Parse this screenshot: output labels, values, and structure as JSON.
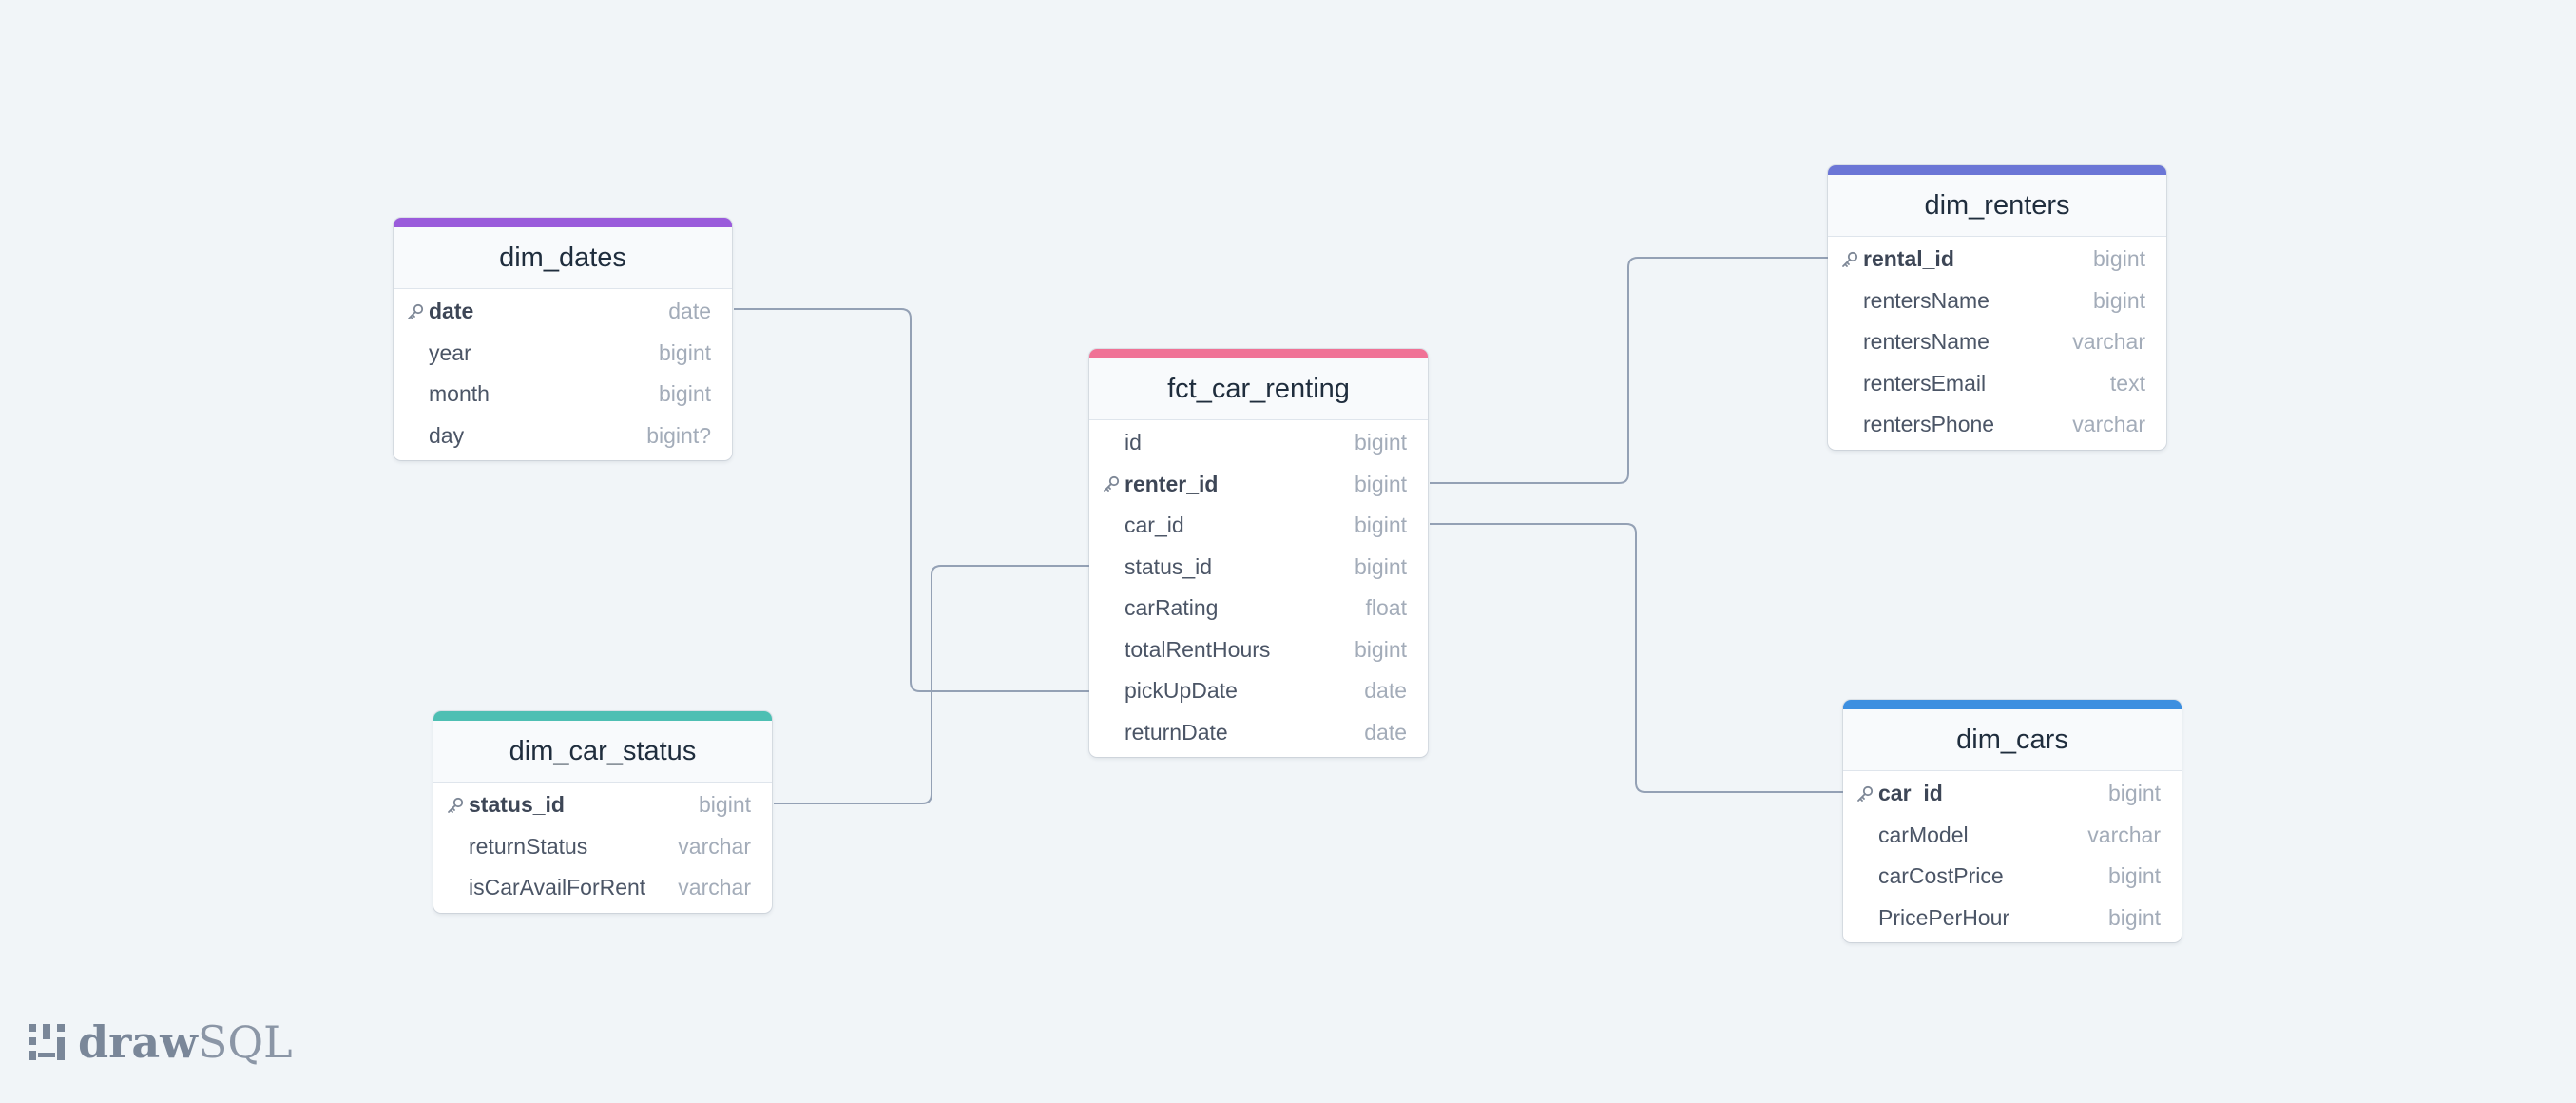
{
  "app": {
    "brand_bold": "draw",
    "brand_light": "SQL"
  },
  "connector_color": "#94a1b5",
  "tables": {
    "dim_dates": {
      "name": "dim_dates",
      "accent": "#9a5bdb",
      "fields": [
        {
          "name": "date",
          "type": "date",
          "pk": true
        },
        {
          "name": "year",
          "type": "bigint",
          "pk": false
        },
        {
          "name": "month",
          "type": "bigint",
          "pk": false
        },
        {
          "name": "day",
          "type": "bigint?",
          "pk": false
        }
      ]
    },
    "dim_car_status": {
      "name": "dim_car_status",
      "accent": "#4ebfb3",
      "fields": [
        {
          "name": "status_id",
          "type": "bigint",
          "pk": true
        },
        {
          "name": "returnStatus",
          "type": "varchar",
          "pk": false
        },
        {
          "name": "isCarAvailForRent",
          "type": "varchar",
          "pk": false
        }
      ]
    },
    "fct_car_renting": {
      "name": "fct_car_renting",
      "accent": "#f07296",
      "fields": [
        {
          "name": "id",
          "type": "bigint",
          "pk": false
        },
        {
          "name": "renter_id",
          "type": "bigint",
          "pk": true
        },
        {
          "name": "car_id",
          "type": "bigint",
          "pk": false
        },
        {
          "name": "status_id",
          "type": "bigint",
          "pk": false
        },
        {
          "name": "carRating",
          "type": "float",
          "pk": false
        },
        {
          "name": "totalRentHours",
          "type": "bigint",
          "pk": false
        },
        {
          "name": "pickUpDate",
          "type": "date",
          "pk": false
        },
        {
          "name": "returnDate",
          "type": "date",
          "pk": false
        }
      ]
    },
    "dim_renters": {
      "name": "dim_renters",
      "accent": "#6b76d6",
      "fields": [
        {
          "name": "rental_id",
          "type": "bigint",
          "pk": true
        },
        {
          "name": "rentersName",
          "type": "bigint",
          "pk": false
        },
        {
          "name": "rentersName",
          "type": "varchar",
          "pk": false
        },
        {
          "name": "rentersEmail",
          "type": "text",
          "pk": false
        },
        {
          "name": "rentersPhone",
          "type": "varchar",
          "pk": false
        }
      ]
    },
    "dim_cars": {
      "name": "dim_cars",
      "accent": "#3d8fe0",
      "fields": [
        {
          "name": "car_id",
          "type": "bigint",
          "pk": true
        },
        {
          "name": "carModel",
          "type": "varchar",
          "pk": false
        },
        {
          "name": "carCostPrice",
          "type": "bigint",
          "pk": false
        },
        {
          "name": "PricePerHour",
          "type": "bigint",
          "pk": false
        }
      ]
    }
  }
}
